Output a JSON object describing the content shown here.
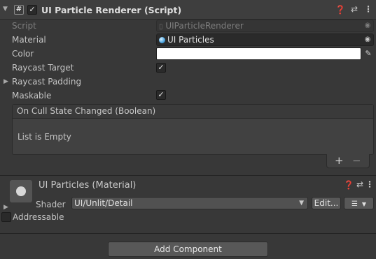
{
  "component": {
    "title": "UI Particle Renderer (Script)",
    "enabled_check": "✓",
    "script_icon": "#",
    "header_icons": [
      "help-icon",
      "presets-icon",
      "kebab-menu-icon"
    ]
  },
  "fields": {
    "script_label": "Script",
    "script_value": "UIParticleRenderer",
    "material_label": "Material",
    "material_value": "UI Particles",
    "color_label": "Color",
    "color_value": "#ffffff",
    "raycast_target_label": "Raycast Target",
    "raycast_target_check": "✓",
    "raycast_padding_label": "Raycast Padding",
    "maskable_label": "Maskable",
    "maskable_check": "✓"
  },
  "event": {
    "header": "On Cull State Changed (Boolean)",
    "empty_text": "List is Empty",
    "add_label": "+",
    "remove_label": "−"
  },
  "material": {
    "title": "UI Particles (Material)",
    "shader_label": "Shader",
    "shader_value": "UI/Unlit/Detail",
    "edit_label": "Edit...",
    "addressable_label": "Addressable"
  },
  "footer": {
    "add_component_label": "Add Component"
  }
}
